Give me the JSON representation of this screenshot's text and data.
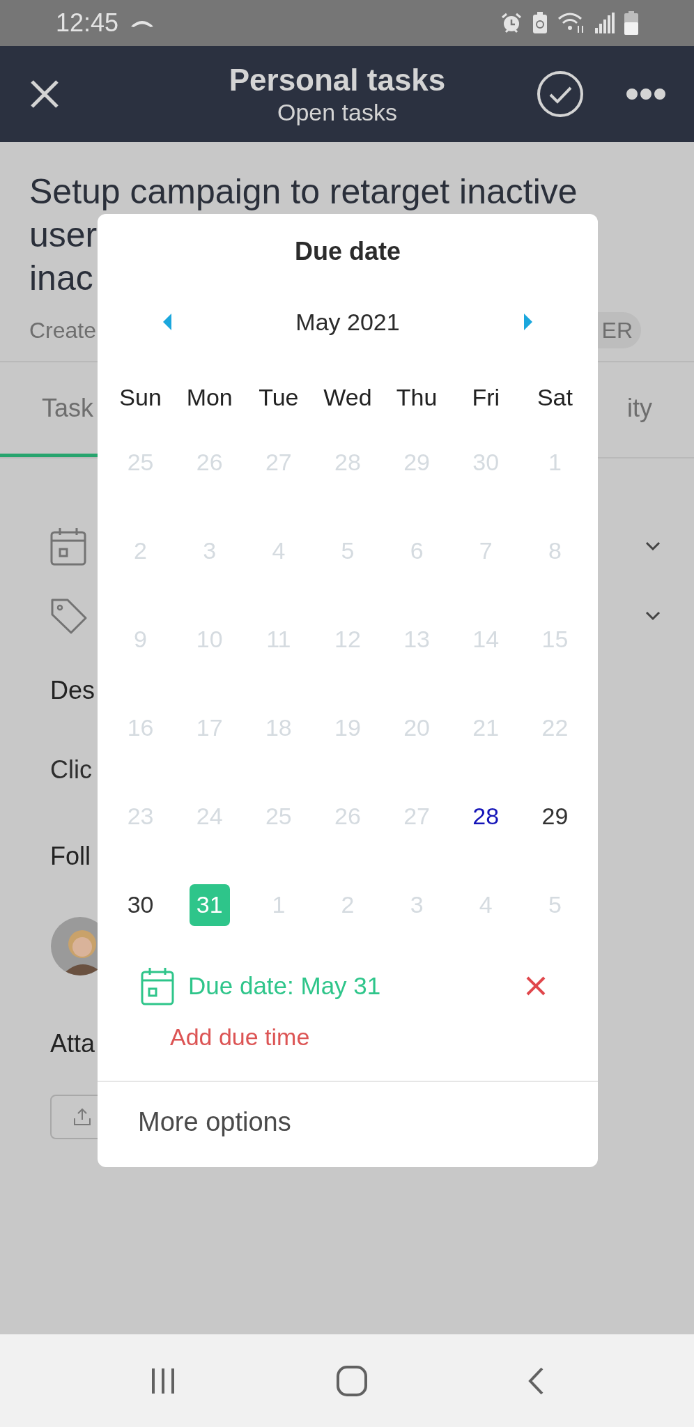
{
  "status_bar": {
    "time": "12:45"
  },
  "header": {
    "title": "Personal tasks",
    "subtitle": "Open tasks"
  },
  "task": {
    "title_lines": [
      "Setup campaign to retarget inactive",
      "user",
      "inac"
    ],
    "created": "Create",
    "tag": "ER",
    "tabs": [
      {
        "label": "Task",
        "selected": true
      },
      {
        "label": "ity",
        "selected": false
      }
    ],
    "description_heading": "Des",
    "description_text": "Clic",
    "followers_heading": "Foll",
    "attachments_heading": "Atta"
  },
  "dialog": {
    "title": "Due date",
    "month": "May 2021",
    "weekdays": [
      "Sun",
      "Mon",
      "Tue",
      "Wed",
      "Thu",
      "Fri",
      "Sat"
    ],
    "weeks": [
      [
        {
          "day": "25",
          "disabled": true,
          "today": false,
          "selected": false
        },
        {
          "day": "26",
          "disabled": true,
          "today": false,
          "selected": false
        },
        {
          "day": "27",
          "disabled": true,
          "today": false,
          "selected": false
        },
        {
          "day": "28",
          "disabled": true,
          "today": false,
          "selected": false
        },
        {
          "day": "29",
          "disabled": true,
          "today": false,
          "selected": false
        },
        {
          "day": "30",
          "disabled": true,
          "today": false,
          "selected": false
        },
        {
          "day": "1",
          "disabled": true,
          "today": false,
          "selected": false
        }
      ],
      [
        {
          "day": "2",
          "disabled": true,
          "today": false,
          "selected": false
        },
        {
          "day": "3",
          "disabled": true,
          "today": false,
          "selected": false
        },
        {
          "day": "4",
          "disabled": true,
          "today": false,
          "selected": false
        },
        {
          "day": "5",
          "disabled": true,
          "today": false,
          "selected": false
        },
        {
          "day": "6",
          "disabled": true,
          "today": false,
          "selected": false
        },
        {
          "day": "7",
          "disabled": true,
          "today": false,
          "selected": false
        },
        {
          "day": "8",
          "disabled": true,
          "today": false,
          "selected": false
        }
      ],
      [
        {
          "day": "9",
          "disabled": true,
          "today": false,
          "selected": false
        },
        {
          "day": "10",
          "disabled": true,
          "today": false,
          "selected": false
        },
        {
          "day": "11",
          "disabled": true,
          "today": false,
          "selected": false
        },
        {
          "day": "12",
          "disabled": true,
          "today": false,
          "selected": false
        },
        {
          "day": "13",
          "disabled": true,
          "today": false,
          "selected": false
        },
        {
          "day": "14",
          "disabled": true,
          "today": false,
          "selected": false
        },
        {
          "day": "15",
          "disabled": true,
          "today": false,
          "selected": false
        }
      ],
      [
        {
          "day": "16",
          "disabled": true,
          "today": false,
          "selected": false
        },
        {
          "day": "17",
          "disabled": true,
          "today": false,
          "selected": false
        },
        {
          "day": "18",
          "disabled": true,
          "today": false,
          "selected": false
        },
        {
          "day": "19",
          "disabled": true,
          "today": false,
          "selected": false
        },
        {
          "day": "20",
          "disabled": true,
          "today": false,
          "selected": false
        },
        {
          "day": "21",
          "disabled": true,
          "today": false,
          "selected": false
        },
        {
          "day": "22",
          "disabled": true,
          "today": false,
          "selected": false
        }
      ],
      [
        {
          "day": "23",
          "disabled": true,
          "today": false,
          "selected": false
        },
        {
          "day": "24",
          "disabled": true,
          "today": false,
          "selected": false
        },
        {
          "day": "25",
          "disabled": true,
          "today": false,
          "selected": false
        },
        {
          "day": "26",
          "disabled": true,
          "today": false,
          "selected": false
        },
        {
          "day": "27",
          "disabled": true,
          "today": false,
          "selected": false
        },
        {
          "day": "28",
          "disabled": false,
          "today": true,
          "selected": false
        },
        {
          "day": "29",
          "disabled": false,
          "today": false,
          "selected": false
        }
      ],
      [
        {
          "day": "30",
          "disabled": false,
          "today": false,
          "selected": false
        },
        {
          "day": "31",
          "disabled": false,
          "today": false,
          "selected": true
        },
        {
          "day": "1",
          "disabled": true,
          "today": false,
          "selected": false
        },
        {
          "day": "2",
          "disabled": true,
          "today": false,
          "selected": false
        },
        {
          "day": "3",
          "disabled": true,
          "today": false,
          "selected": false
        },
        {
          "day": "4",
          "disabled": true,
          "today": false,
          "selected": false
        },
        {
          "day": "5",
          "disabled": true,
          "today": false,
          "selected": false
        }
      ]
    ],
    "due_label": "Due date: May 31",
    "add_time": "Add due time",
    "more_options": "More options"
  }
}
